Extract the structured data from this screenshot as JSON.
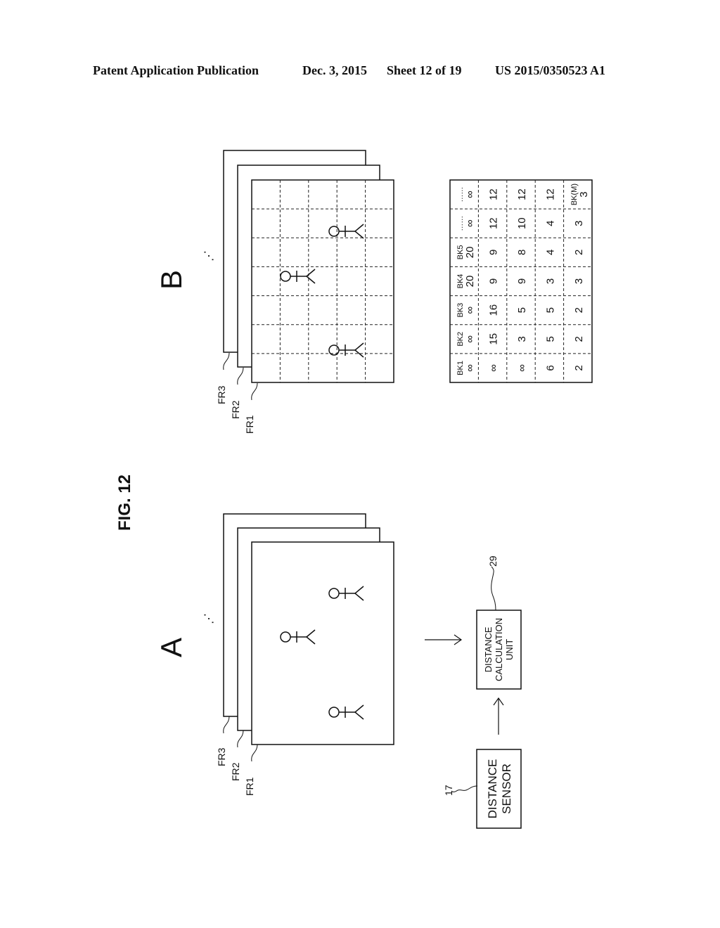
{
  "header": {
    "publication": "Patent Application Publication",
    "date": "Dec. 3, 2015",
    "sheet": "Sheet 12 of 19",
    "number": "US 2015/0350523 A1"
  },
  "figure": {
    "title": "FIG. 12",
    "panel_a": {
      "label": "A",
      "frames": [
        "FR1",
        "FR2",
        "FR3"
      ],
      "ellipsis": "⋰",
      "persons": 3,
      "blocks": {
        "sensor": {
          "ref": "17",
          "lines": [
            "DISTANCE",
            "SENSOR"
          ]
        },
        "calc": {
          "ref": "29",
          "lines": [
            "DISTANCE",
            "CALCULATION",
            "UNIT"
          ]
        }
      }
    },
    "panel_b": {
      "label": "B",
      "frames": [
        "FR1",
        "FR2",
        "FR3"
      ],
      "ellipsis": "⋰",
      "grid": {
        "rows": 7,
        "cols": 5
      },
      "persons": 3
    },
    "table": {
      "headers": [
        "BK1",
        "BK2",
        "BK3",
        "BK4",
        "BK5",
        "……",
        "……"
      ],
      "rows": [
        [
          "∞",
          "∞",
          "∞",
          "20",
          "20",
          "∞",
          "∞"
        ],
        [
          "∞",
          "15",
          "16",
          "9",
          "9",
          "12",
          "12"
        ],
        [
          "∞",
          "3",
          "5",
          "9",
          "8",
          "10",
          "12"
        ],
        [
          "6",
          "5",
          "5",
          "3",
          "4",
          "4",
          "12"
        ],
        [
          "2",
          "2",
          "2",
          "3",
          "2",
          "3",
          "3"
        ]
      ],
      "last_row_last_header": "BK(M)"
    }
  }
}
